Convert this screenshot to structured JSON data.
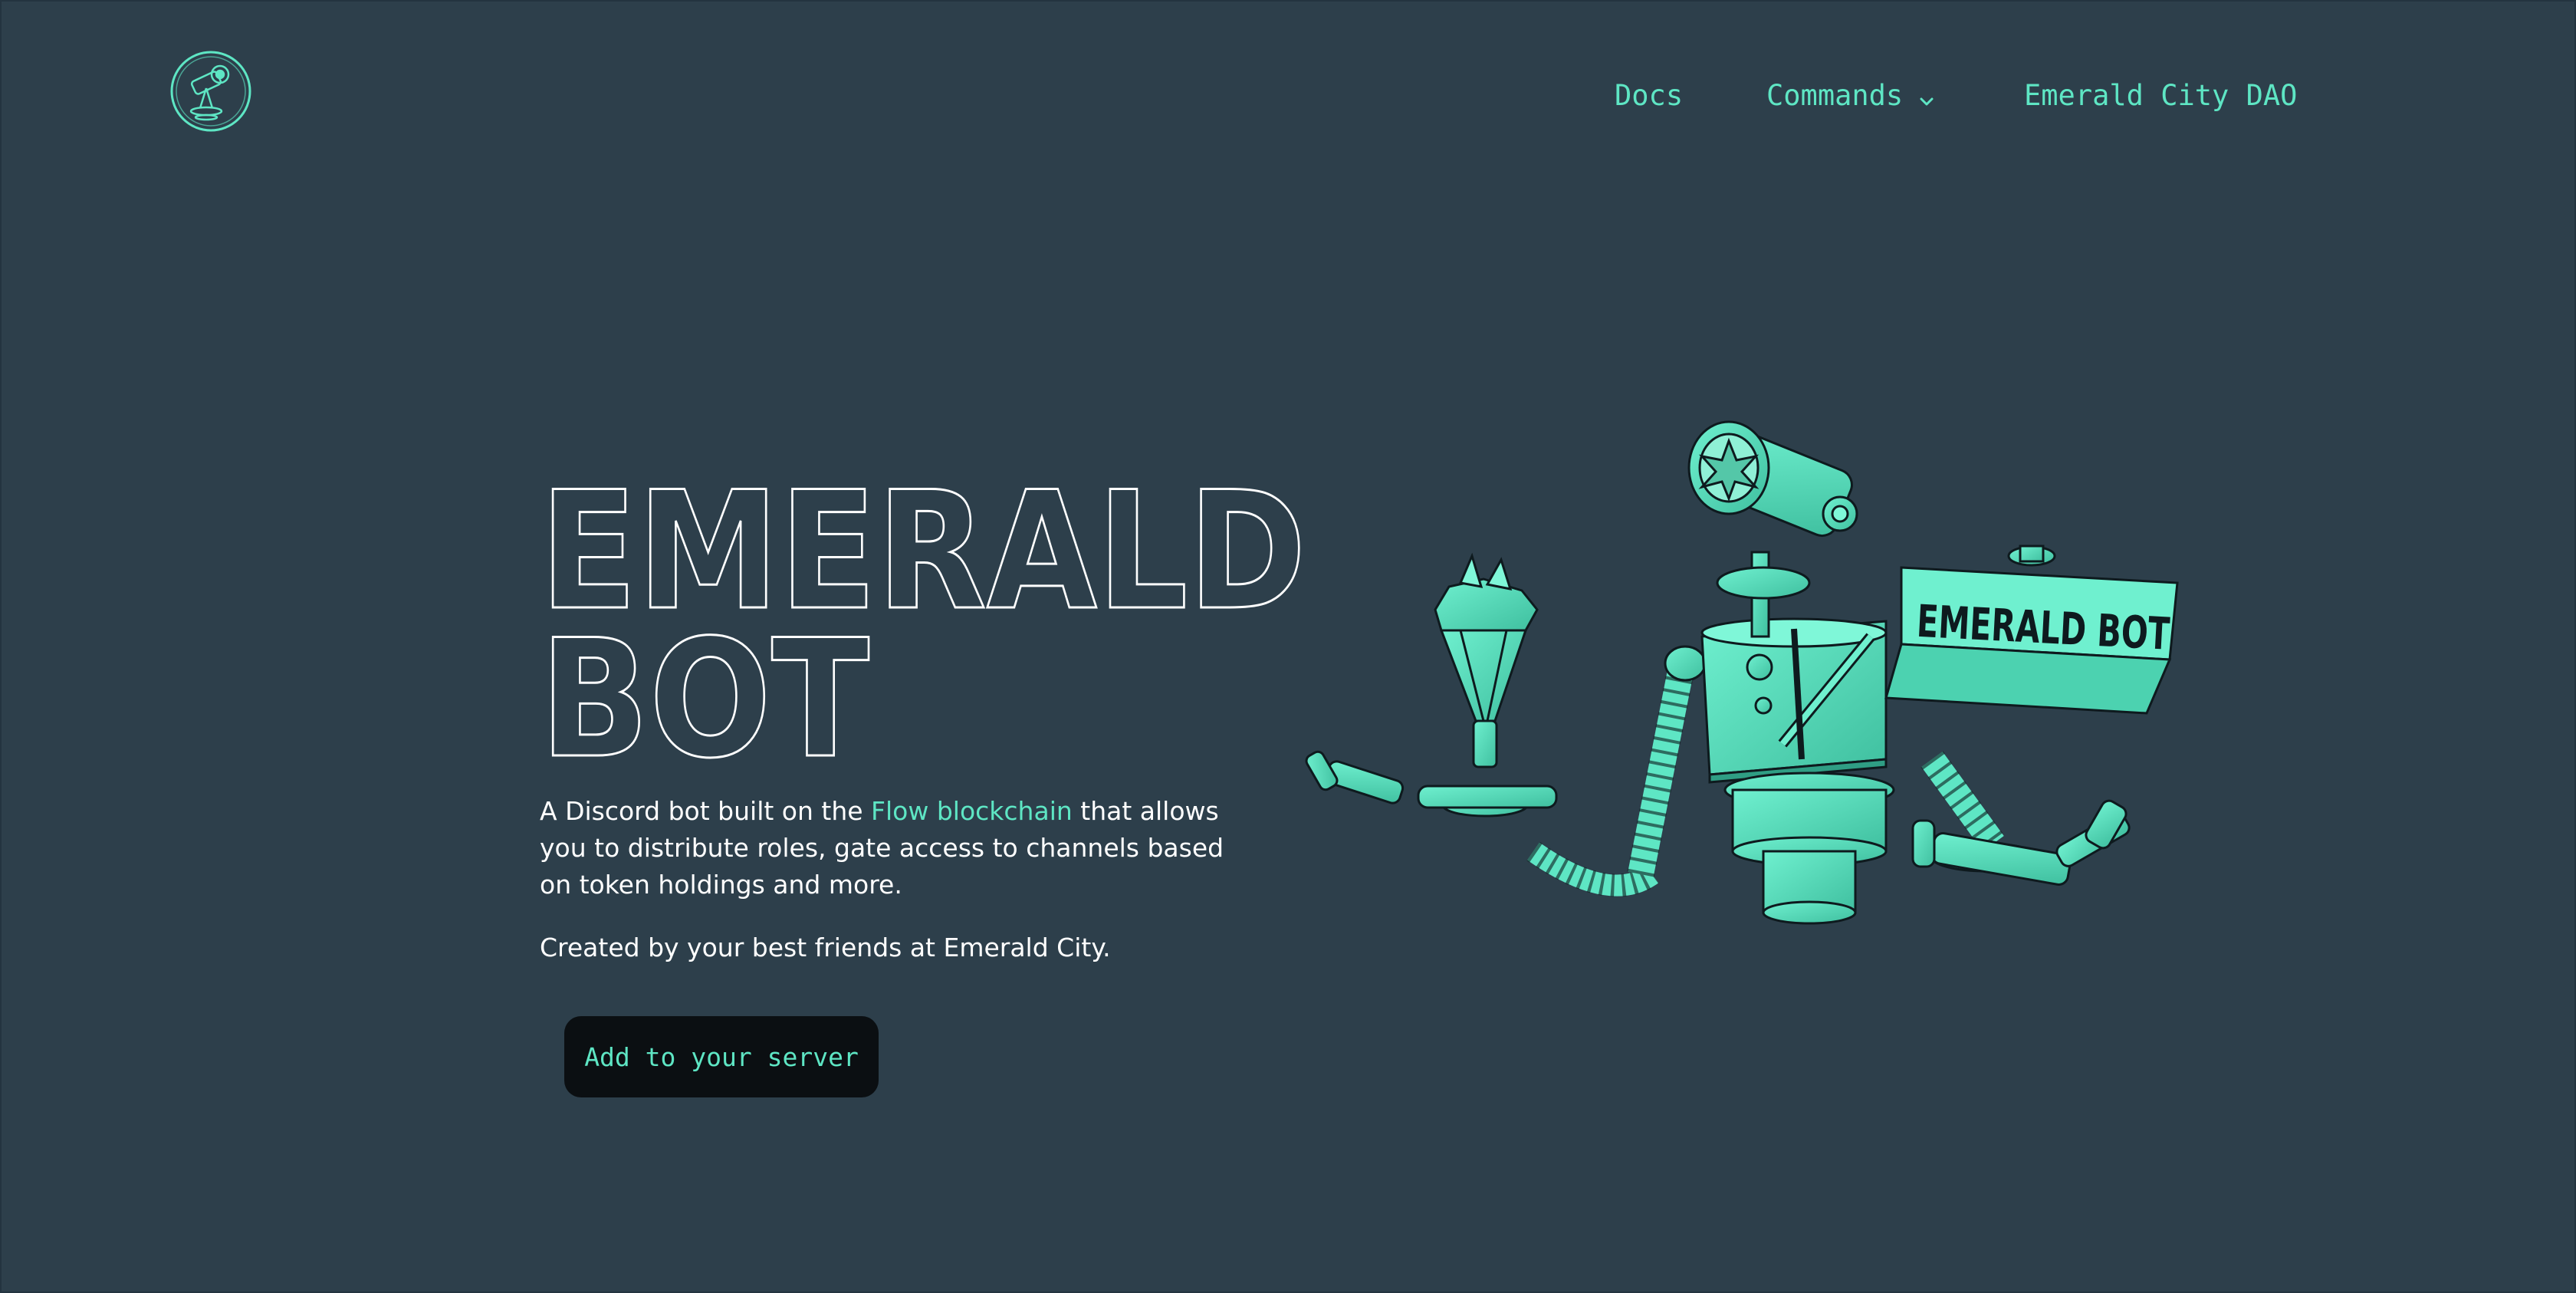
{
  "header": {
    "logo_icon": "telescope-logo-icon",
    "nav": {
      "docs": "Docs",
      "commands": "Commands",
      "dao": "Emerald City DAO"
    }
  },
  "hero": {
    "title_line1": "EMERALD",
    "title_line2": "BOT",
    "desc_before": "A Discord bot built on the ",
    "desc_link": "Flow blockchain",
    "desc_after": " that allows you to distribute roles, gate access to channels based on token holdings and more.",
    "credit": "Created by your best friends at Emerald City.",
    "cta": "Add to your server",
    "illustration_sign": "EMERALD BOT"
  },
  "colors": {
    "background": "#2d3f4b",
    "accent": "#5ee6c4",
    "button_bg": "#0b0f12",
    "text": "#ffffff"
  }
}
